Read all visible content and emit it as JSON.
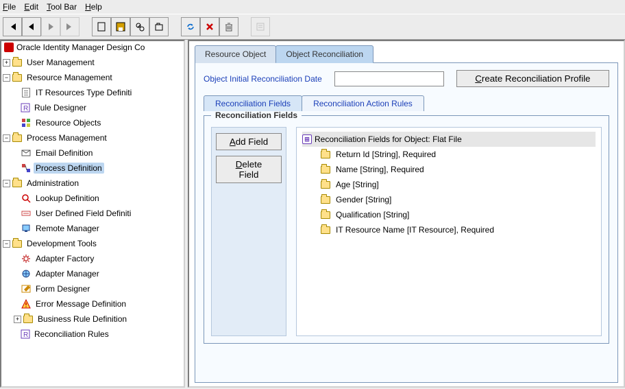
{
  "menu": {
    "file": "File",
    "edit": "Edit",
    "toolbar": "Tool Bar",
    "help": "Help"
  },
  "sidebar": {
    "title": "Oracle Identity Manager Design Co",
    "nodes": {
      "user_mgmt": "User Management",
      "res_mgmt": "Resource Management",
      "it_res_type": "IT Resources Type Definiti",
      "rule_designer": "Rule Designer",
      "resource_objects": "Resource Objects",
      "proc_mgmt": "Process Management",
      "email_def": "Email Definition",
      "proc_def": "Process Definition",
      "admin": "Administration",
      "lookup_def": "Lookup Definition",
      "udf_def": "User Defined Field Definiti",
      "remote_mgr": "Remote Manager",
      "dev_tools": "Development Tools",
      "adapter_factory": "Adapter Factory",
      "adapter_manager": "Adapter Manager",
      "form_designer": "Form Designer",
      "error_msg_def": "Error Message Definition",
      "biz_rule_def": "Business Rule Definition",
      "recon_rules": "Reconciliation Rules"
    }
  },
  "content": {
    "tabs": {
      "resource_object": "Resource Object",
      "object_recon": "Object Reconciliation"
    },
    "form": {
      "date_label": "Object Initial Reconciliation Date",
      "date_value": "",
      "create_profile": "Create Reconciliation Profile"
    },
    "subtabs": {
      "fields": "Reconciliation Fields",
      "rules": "Reconciliation Action Rules"
    },
    "fieldset_legend": "Reconciliation Fields",
    "buttons": {
      "add_field": "Add Field",
      "delete_field": "Delete Field"
    },
    "recon_tree": {
      "root": "Reconciliation Fields for Object: Flat File",
      "items": [
        "Return Id [String], Required",
        "Name [String], Required",
        "Age [String]",
        "Gender [String]",
        "Qualification [String]",
        "IT Resource Name [IT Resource], Required"
      ]
    }
  }
}
